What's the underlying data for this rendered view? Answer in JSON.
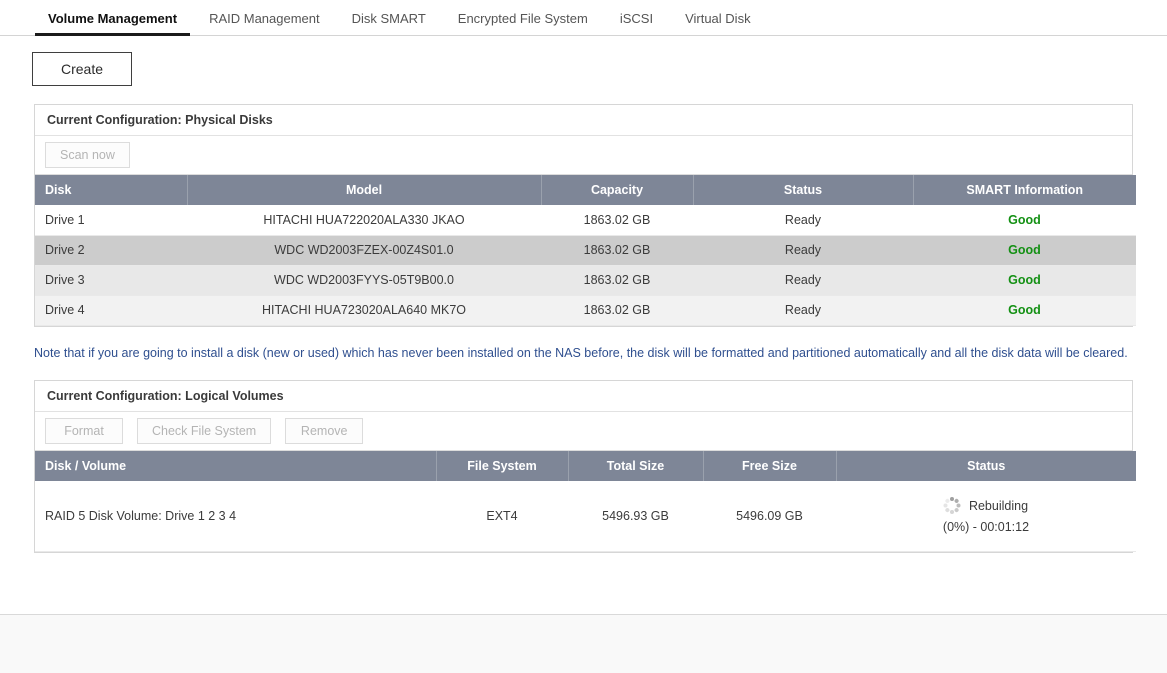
{
  "tabs": [
    {
      "label": "Volume Management",
      "active": true
    },
    {
      "label": "RAID Management",
      "active": false
    },
    {
      "label": "Disk SMART",
      "active": false
    },
    {
      "label": "Encrypted File System",
      "active": false
    },
    {
      "label": "iSCSI",
      "active": false
    },
    {
      "label": "Virtual Disk",
      "active": false
    }
  ],
  "toolbar": {
    "create_label": "Create"
  },
  "physical": {
    "panel_title": "Current Configuration: Physical Disks",
    "scan_label": "Scan now",
    "columns": [
      "Disk",
      "Model",
      "Capacity",
      "Status",
      "SMART Information"
    ],
    "rows": [
      {
        "disk": "Drive 1",
        "model": "HITACHI HUA722020ALA330 JKAO",
        "capacity": "1863.02 GB",
        "status": "Ready",
        "smart": "Good"
      },
      {
        "disk": "Drive 2",
        "model": "WDC WD2003FZEX-00Z4S01.0",
        "capacity": "1863.02 GB",
        "status": "Ready",
        "smart": "Good"
      },
      {
        "disk": "Drive 3",
        "model": "WDC WD2003FYYS-05T9B00.0",
        "capacity": "1863.02 GB",
        "status": "Ready",
        "smart": "Good"
      },
      {
        "disk": "Drive 4",
        "model": "HITACHI HUA723020ALA640 MK7O",
        "capacity": "1863.02 GB",
        "status": "Ready",
        "smart": "Good"
      }
    ]
  },
  "note": "Note that if you are going to install a disk (new or used) which has never been installed on the NAS before, the disk will be formatted and partitioned automatically and all the disk data will be cleared.",
  "logical": {
    "panel_title": "Current Configuration: Logical Volumes",
    "format_label": "Format",
    "check_label": "Check File System",
    "remove_label": "Remove",
    "columns": [
      "Disk / Volume",
      "File System",
      "Total Size",
      "Free Size",
      "Status"
    ],
    "rows": [
      {
        "volume": "RAID 5 Disk Volume: Drive 1 2 3 4",
        "filesystem": "EXT4",
        "total_size": "5496.93 GB",
        "free_size": "5496.09 GB",
        "status_label": "Rebuilding",
        "status_detail": "(0%) - 00:01:12",
        "status_icon": "spinner-icon"
      }
    ]
  },
  "colors": {
    "header_bg": "#7e8697",
    "note_text": "#2f4f8f",
    "smart_good": "#139013",
    "selected_row": "#cccccc"
  }
}
